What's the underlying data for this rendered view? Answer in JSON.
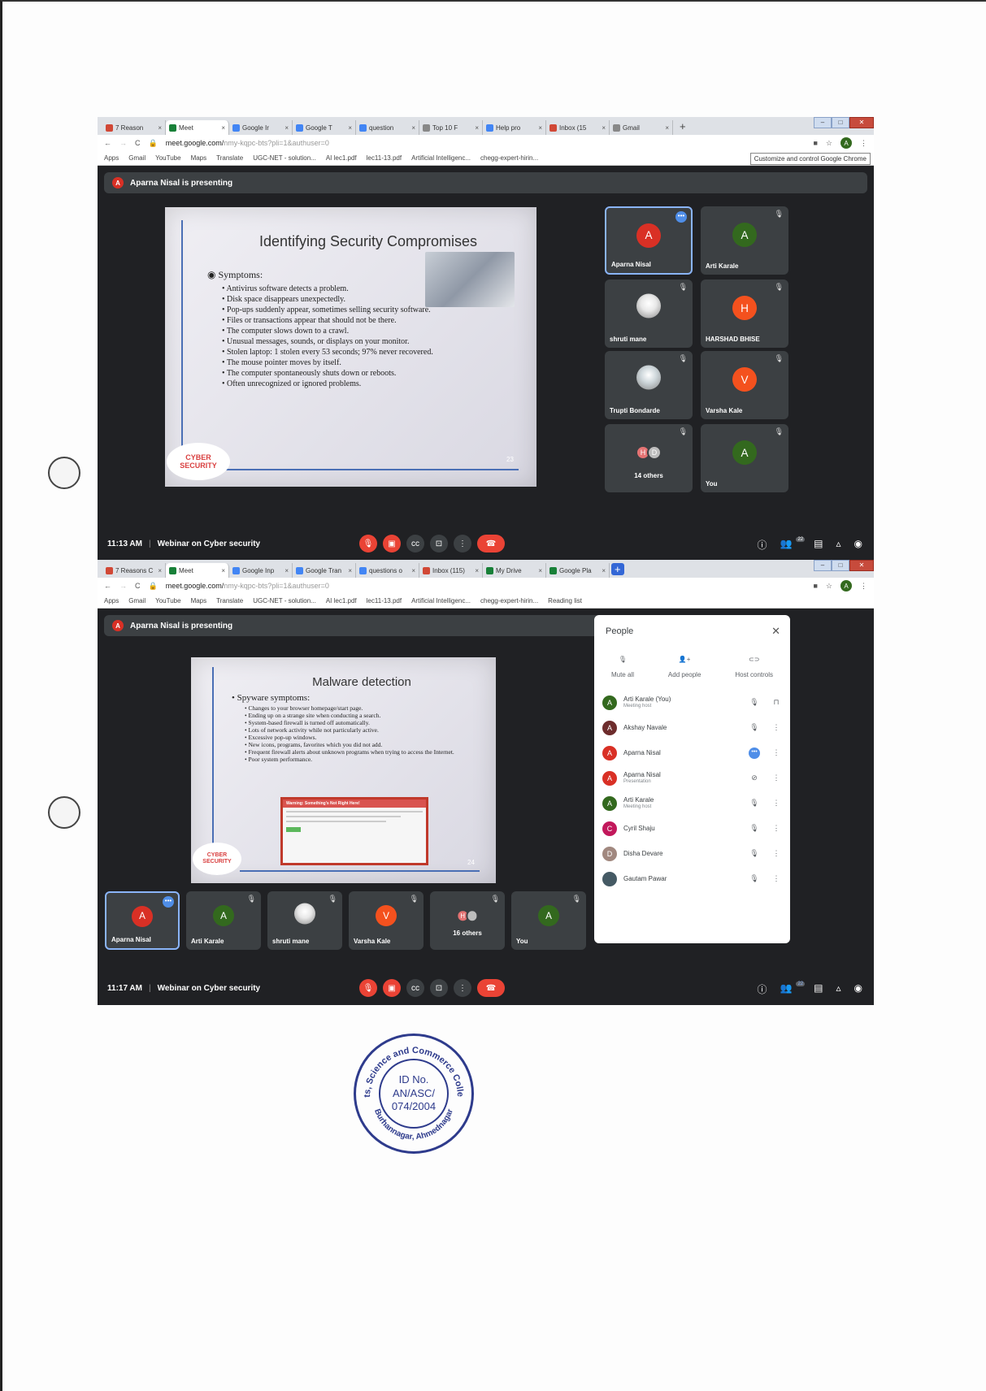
{
  "shot1": {
    "tabs": [
      {
        "label": "7 Reason",
        "color": "#d14836"
      },
      {
        "label": "Meet",
        "color": "#188038"
      },
      {
        "label": "Google Ir",
        "color": "#4285f4"
      },
      {
        "label": "Google T",
        "color": "#4285f4"
      },
      {
        "label": "question",
        "color": "#4285f4"
      },
      {
        "label": "Top 10 F",
        "color": "#888888"
      },
      {
        "label": "Help pro",
        "color": "#4285f4"
      },
      {
        "label": "Inbox (15",
        "color": "#d14836"
      },
      {
        "label": "Gmail",
        "color": "#888888"
      }
    ],
    "url": "meet.google.com/",
    "url_dim": "nmy-kqpc-bts?pli=1&authuser=0",
    "bookmarks": [
      "Apps",
      "Gmail",
      "YouTube",
      "Maps",
      "Translate",
      "UGC-NET - solution...",
      "AI lec1.pdf",
      "lec11-13.pdf",
      "Artificial Intelligenc...",
      "chegg-expert-hirin..."
    ],
    "tooltip": "Customize and control Google Chrome",
    "presenting": "Aparna Nisal is presenting",
    "presenter_initial": "A",
    "slide": {
      "title": "Identifying Security Compromises",
      "heading": "Symptoms:",
      "bullets": [
        "Antivirus software detects a problem.",
        "Disk space disappears unexpectedly.",
        "Pop-ups suddenly appear, sometimes selling security software.",
        "Files or transactions appear that should not be there.",
        "The computer slows down to a crawl.",
        "Unusual messages, sounds, or displays on your monitor.",
        "Stolen laptop: 1 stolen every 53 seconds; 97% never recovered.",
        "The mouse pointer moves by itself.",
        "The computer spontaneously shuts down or reboots.",
        "Often unrecognized or ignored problems."
      ],
      "logo_l1": "CYBER",
      "logo_l2": "SECURITY",
      "page": "23"
    },
    "tiles": [
      {
        "name": "Aparna Nisal",
        "initial": "A",
        "color": "#d93025"
      },
      {
        "name": "Arti Karale",
        "initial": "A",
        "color": "#33691e"
      },
      {
        "name": "shruti mane",
        "initial": "",
        "color": "#e8e8e8"
      },
      {
        "name": "HARSHAD BHISE",
        "initial": "H",
        "color": "#f4511e"
      },
      {
        "name": "Trupti Bondarde",
        "initial": "",
        "color": "#cfd8dc"
      },
      {
        "name": "Varsha Kale",
        "initial": "V",
        "color": "#f4511e"
      },
      {
        "name": "14 others",
        "initial": "H",
        "color": "#e57373"
      },
      {
        "name": "You",
        "initial": "A",
        "color": "#33691e"
      }
    ],
    "others_second_initial": "D",
    "time": "11:13 AM",
    "meeting": "Webinar on Cyber security",
    "participants_count": "22"
  },
  "shot2": {
    "tabs": [
      {
        "label": "7 Reasons C",
        "color": "#d14836"
      },
      {
        "label": "Meet",
        "color": "#188038"
      },
      {
        "label": "Google Inp",
        "color": "#4285f4"
      },
      {
        "label": "Google Tran",
        "color": "#4285f4"
      },
      {
        "label": "questions o",
        "color": "#4285f4"
      },
      {
        "label": "Inbox (115)",
        "color": "#d14836"
      },
      {
        "label": "My Drive",
        "color": "#188038"
      },
      {
        "label": "Google Pla",
        "color": "#188038"
      }
    ],
    "url": "meet.google.com/",
    "url_dim": "nmy-kqpc-bts?pli=1&authuser=0",
    "bookmarks": [
      "Apps",
      "Gmail",
      "YouTube",
      "Maps",
      "Translate",
      "UGC-NET - solution...",
      "AI lec1.pdf",
      "lec11-13.pdf",
      "Artificial Intelligenc...",
      "chegg-expert-hirin...",
      "Reading list"
    ],
    "presenting": "Aparna Nisal is presenting",
    "presenter_initial": "A",
    "slide": {
      "title": "Malware detection",
      "heading": "Spyware symptoms:",
      "bullets": [
        "Changes to your browser homepage/start page.",
        "Ending up on a strange site when conducting a search.",
        "System-based firewall is turned off automatically.",
        "Lots of network activity while not particularly active.",
        "Excessive pop-up windows.",
        "New icons, programs, favorites which you did not add.",
        "Frequent firewall alerts about unknown programs when trying to access the Internet.",
        "Poor system performance."
      ],
      "popup_title": "Warning: Something's Not Right Here!",
      "logo_l1": "CYBER",
      "logo_l2": "SECURITY",
      "page": "24"
    },
    "tiles": [
      {
        "name": "Aparna Nisal",
        "initial": "A",
        "color": "#d93025"
      },
      {
        "name": "Arti Karale",
        "initial": "A",
        "color": "#33691e"
      },
      {
        "name": "shruti mane",
        "initial": "",
        "color": "#e8e8e8"
      },
      {
        "name": "Varsha Kale",
        "initial": "V",
        "color": "#f4511e"
      },
      {
        "name": "16 others",
        "initial": "H",
        "color": "#e57373"
      },
      {
        "name": "You",
        "initial": "A",
        "color": "#33691e"
      }
    ],
    "panel": {
      "title": "People",
      "actions": [
        "Mute all",
        "Add people",
        "Host controls"
      ],
      "people": [
        {
          "name": "Arti Karale (You)",
          "sub": "Meeting host",
          "initial": "A",
          "color": "#33691e"
        },
        {
          "name": "Akshay Navale",
          "sub": "",
          "initial": "A",
          "color": "#6d2c2c"
        },
        {
          "name": "Aparna Nisal",
          "sub": "",
          "initial": "A",
          "color": "#d93025"
        },
        {
          "name": "Aparna Nisal",
          "sub": "Presentation",
          "initial": "A",
          "color": "#d93025"
        },
        {
          "name": "Arti Karale",
          "sub": "Meeting host",
          "initial": "A",
          "color": "#33691e"
        },
        {
          "name": "Cyril Shaju",
          "sub": "",
          "initial": "C",
          "color": "#c2185b"
        },
        {
          "name": "Disha Devare",
          "sub": "",
          "initial": "D",
          "color": "#a1887f"
        },
        {
          "name": "Gautam Pawar",
          "sub": "",
          "initial": "",
          "color": "#455a64"
        }
      ]
    },
    "time": "11:17 AM",
    "meeting": "Webinar on Cyber security",
    "participants_count": "22"
  },
  "stamp": {
    "top_arc": "Arts, Science and Commerce College",
    "bottom_arc": "Burhannagar, Ahmednagar",
    "line1": "ID No.",
    "line2": "AN/ASC/",
    "line3": "074/2004"
  }
}
